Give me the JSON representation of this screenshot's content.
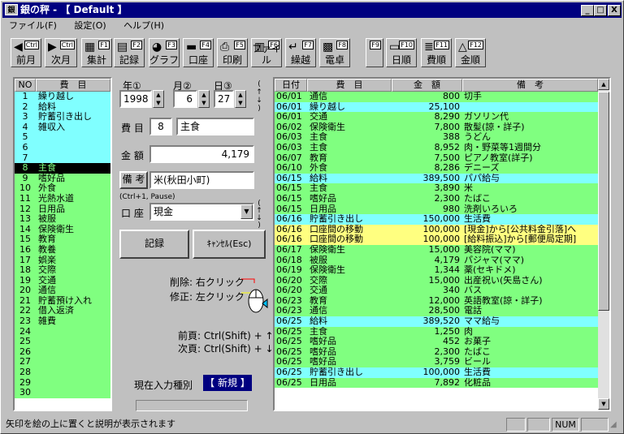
{
  "title": "銀の秤 - 【 Default 】",
  "app_icon": "銀",
  "window_buttons": {
    "minimize": "_",
    "maximize": "□",
    "close": "X"
  },
  "menu": [
    "ファイル(F)",
    "設定(O)",
    "ヘルプ(H)"
  ],
  "toolbar": [
    {
      "label": "前月",
      "key": "Ctrl",
      "icon": "◀"
    },
    {
      "label": "次月",
      "key": "Ctrl",
      "icon": "▶"
    },
    {
      "label": "集計",
      "key": "F1",
      "icon": "▦"
    },
    {
      "label": "記録",
      "key": "F2",
      "icon": "▤"
    },
    {
      "label": "グラフ",
      "key": "F3",
      "icon": "◕"
    },
    {
      "label": "口座",
      "key": "F4",
      "icon": "▬"
    },
    {
      "label": "印刷",
      "key": "F5",
      "icon": "⎙"
    },
    {
      "label": "ファイル",
      "key": "F6",
      "icon": "▥"
    },
    {
      "label": "繰越",
      "key": "F7",
      "icon": "↵"
    },
    {
      "label": "電卓",
      "key": "F8",
      "icon": "▩"
    },
    {
      "label": "",
      "key": "F9",
      "icon": ""
    },
    {
      "label": "日順",
      "key": "F10",
      "icon": "▭"
    },
    {
      "label": "費順",
      "key": "F11",
      "icon": "≣"
    },
    {
      "label": "金順",
      "key": "F12",
      "icon": "△"
    }
  ],
  "category_list": {
    "headers": [
      "NO",
      "費　目"
    ],
    "items": [
      {
        "no": "1",
        "name": "繰り越し",
        "bg": "#80ffff"
      },
      {
        "no": "2",
        "name": "給料",
        "bg": "#80ffff"
      },
      {
        "no": "3",
        "name": "貯蓄引き出し",
        "bg": "#80ffff"
      },
      {
        "no": "4",
        "name": "雑収入",
        "bg": "#80ffff"
      },
      {
        "no": "5",
        "name": "",
        "bg": "#80ffff"
      },
      {
        "no": "6",
        "name": "",
        "bg": "#80ffff"
      },
      {
        "no": "7",
        "name": "",
        "bg": "#80ffff"
      },
      {
        "no": "8",
        "name": "主食",
        "bg": "#000000",
        "fg": "#80ff80"
      },
      {
        "no": "9",
        "name": "嗜好品",
        "bg": "#80ff80"
      },
      {
        "no": "10",
        "name": "外食",
        "bg": "#80ff80"
      },
      {
        "no": "11",
        "name": "光熱水道",
        "bg": "#80ff80"
      },
      {
        "no": "12",
        "name": "日用品",
        "bg": "#80ff80"
      },
      {
        "no": "13",
        "name": "被服",
        "bg": "#80ff80"
      },
      {
        "no": "14",
        "name": "保険衛生",
        "bg": "#80ff80"
      },
      {
        "no": "15",
        "name": "教育",
        "bg": "#80ff80"
      },
      {
        "no": "16",
        "name": "教養",
        "bg": "#80ff80"
      },
      {
        "no": "17",
        "name": "娯楽",
        "bg": "#80ff80"
      },
      {
        "no": "18",
        "name": "交際",
        "bg": "#80ff80"
      },
      {
        "no": "19",
        "name": "交通",
        "bg": "#80ff80"
      },
      {
        "no": "20",
        "name": "通信",
        "bg": "#80ff80"
      },
      {
        "no": "21",
        "name": "貯蓄預け入れ",
        "bg": "#80ff80"
      },
      {
        "no": "22",
        "name": "借入返済",
        "bg": "#80ff80"
      },
      {
        "no": "23",
        "name": "雑費",
        "bg": "#80ff80"
      },
      {
        "no": "24",
        "name": "",
        "bg": "#80ff80"
      },
      {
        "no": "25",
        "name": "",
        "bg": "#80ff80"
      },
      {
        "no": "26",
        "name": "",
        "bg": "#80ff80"
      },
      {
        "no": "27",
        "name": "",
        "bg": "#80ff80"
      },
      {
        "no": "28",
        "name": "",
        "bg": "#80ff80"
      },
      {
        "no": "29",
        "name": "",
        "bg": "#80ff80"
      },
      {
        "no": "30",
        "name": "",
        "bg": "#80ff80"
      }
    ]
  },
  "form": {
    "year_label": "年①",
    "year": "1998",
    "month_label": "月②",
    "month": "6",
    "day_label": "日③",
    "day": "27",
    "category_label": "費 目",
    "category_no": "8",
    "category_name": "主食",
    "amount_label": "金 額",
    "amount": "4,179",
    "note_button": "備 考",
    "note": "米(秋田小町)",
    "note_hint": "(Ctrl+1, Pause)",
    "account_label": "口 座",
    "account": "現金",
    "record_button": "記録",
    "cancel_button": "ｷｬﾝｾﾙ(Esc)",
    "delete_hint": "削除: 右クリック",
    "edit_hint": "修正: 左クリック",
    "prev_page": "前頁: Ctrl(Shift) + ↑",
    "next_page": "次頁: Ctrl(Shift) + ↓",
    "input_type_label": "現在入力種別",
    "input_type": "【 新規 】"
  },
  "entries": {
    "headers": [
      "日付",
      "費　目",
      "金　額",
      "備　考"
    ],
    "rows": [
      {
        "date": "06/01",
        "cat": "通信",
        "amt": "800",
        "note": "切手",
        "bg": "#80ff80"
      },
      {
        "date": "06/01",
        "cat": "繰り越し",
        "amt": "25,100",
        "note": "",
        "bg": "#80ffff"
      },
      {
        "date": "06/01",
        "cat": "交通",
        "amt": "8,290",
        "note": "ガソリン代",
        "bg": "#80ff80"
      },
      {
        "date": "06/02",
        "cat": "保険衛生",
        "amt": "7,800",
        "note": "散髪(諒・詳子)",
        "bg": "#80ff80"
      },
      {
        "date": "06/03",
        "cat": "主食",
        "amt": "388",
        "note": "うどん",
        "bg": "#80ff80"
      },
      {
        "date": "06/03",
        "cat": "主食",
        "amt": "8,952",
        "note": "肉・野菜等1週間分",
        "bg": "#80ff80"
      },
      {
        "date": "06/07",
        "cat": "教育",
        "amt": "7,500",
        "note": "ピアノ教室(詳子)",
        "bg": "#80ff80"
      },
      {
        "date": "06/10",
        "cat": "外食",
        "amt": "8,286",
        "note": "デニーズ",
        "bg": "#80ff80"
      },
      {
        "date": "06/15",
        "cat": "給料",
        "amt": "389,500",
        "note": "パパ給与",
        "bg": "#80ffff"
      },
      {
        "date": "06/15",
        "cat": "主食",
        "amt": "3,890",
        "note": "米",
        "bg": "#80ff80"
      },
      {
        "date": "06/15",
        "cat": "嗜好品",
        "amt": "2,300",
        "note": "たばこ",
        "bg": "#80ff80"
      },
      {
        "date": "06/15",
        "cat": "日用品",
        "amt": "980",
        "note": "洗剤いろいろ",
        "bg": "#80ff80"
      },
      {
        "date": "06/16",
        "cat": "貯蓄引き出し",
        "amt": "150,000",
        "note": "生活費",
        "bg": "#80ffff"
      },
      {
        "date": "06/16",
        "cat": "口座間の移動",
        "amt": "100,000",
        "note": "[現金]から[公共料金引落]へ",
        "bg": "#ffff80"
      },
      {
        "date": "06/16",
        "cat": "口座間の移動",
        "amt": "100,000",
        "note": "[給料振込]から[郵便局定期]",
        "bg": "#ffff80"
      },
      {
        "date": "06/17",
        "cat": "保険衛生",
        "amt": "15,000",
        "note": "美容院(ママ)",
        "bg": "#80ff80"
      },
      {
        "date": "06/18",
        "cat": "被服",
        "amt": "4,179",
        "note": "パジャマ(ママ)",
        "bg": "#80ff80"
      },
      {
        "date": "06/19",
        "cat": "保険衛生",
        "amt": "1,344",
        "note": "薬(セキドメ)",
        "bg": "#80ff80"
      },
      {
        "date": "06/20",
        "cat": "交際",
        "amt": "15,000",
        "note": "出産祝い(矢島さん)",
        "bg": "#80ff80"
      },
      {
        "date": "06/20",
        "cat": "交通",
        "amt": "340",
        "note": "バス",
        "bg": "#80ff80"
      },
      {
        "date": "06/23",
        "cat": "教育",
        "amt": "12,000",
        "note": "英語教室(諒・詳子)",
        "bg": "#80ff80"
      },
      {
        "date": "06/23",
        "cat": "通信",
        "amt": "28,500",
        "note": "電話",
        "bg": "#80ff80"
      },
      {
        "date": "06/25",
        "cat": "給料",
        "amt": "389,520",
        "note": "ママ給与",
        "bg": "#80ffff"
      },
      {
        "date": "06/25",
        "cat": "主食",
        "amt": "1,250",
        "note": "肉",
        "bg": "#80ff80"
      },
      {
        "date": "06/25",
        "cat": "嗜好品",
        "amt": "452",
        "note": "お菓子",
        "bg": "#80ff80"
      },
      {
        "date": "06/25",
        "cat": "嗜好品",
        "amt": "2,300",
        "note": "たばこ",
        "bg": "#80ff80"
      },
      {
        "date": "06/25",
        "cat": "嗜好品",
        "amt": "3,759",
        "note": "ビール",
        "bg": "#80ff80"
      },
      {
        "date": "06/25",
        "cat": "貯蓄引き出し",
        "amt": "100,000",
        "note": "生活費",
        "bg": "#80ffff"
      },
      {
        "date": "06/25",
        "cat": "日用品",
        "amt": "7,892",
        "note": "化粧品",
        "bg": "#80ff80"
      }
    ]
  },
  "status": {
    "message": "矢印を絵の上に置くと説明が表示されます",
    "num": "NUM"
  }
}
